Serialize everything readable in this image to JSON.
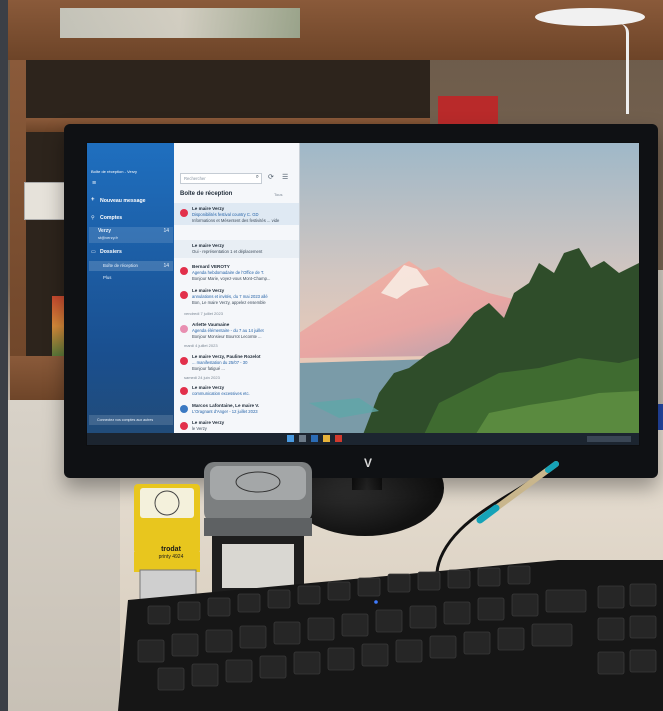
{
  "mail_app": {
    "window_title": "Boîte de réception - Verzy",
    "new_message": "Nouveau message",
    "accounts_label": "Comptes",
    "account_name": "Verzy",
    "account_email": "st@verzy.fr",
    "account_count": "14",
    "folders_label": "Dossiers",
    "folder_inbox": "Boîte de réception",
    "folder_inbox_count": "14",
    "folder_more": "Plus",
    "search_placeholder": "Rechercher",
    "list_header": "Boîte de réception",
    "filter_label": "Tous",
    "bottom_notice": "Connectez vos comptes aux autres",
    "items": [
      {
        "sender": "Le maire Verzy",
        "subject": "Disponibilités festival country C. GD",
        "preview": "Informations et Mésentent des festivités ... vide"
      },
      {
        "sender": "Le maire Verzy",
        "subject": "Oui - représentation 1 et déplacement",
        "preview": "... vide"
      },
      {
        "sender": "Bernard VEROTY",
        "subject": "Agenda hebdomadaire de l'Office de T.",
        "preview": "Bonjour Marie, voyez-vous Mont-Champ..."
      },
      {
        "sender": "Le maire Verzy",
        "subject": "annulations et invités, du 7 mai 2023 allé",
        "preview": "Bon, Le maire Verzy, appelez ensemble"
      }
    ],
    "group_day": "vendredi 7 juillet 2023",
    "items_b": [
      {
        "sender": "Arlette Vaumaine",
        "subject": "Agenda élémentaire - du 7 au 14 juillet",
        "preview": "Bonjour Monsieur Bourrot Lecomte ..."
      }
    ],
    "group_day_b": "mardi 4 juillet 2023",
    "items_c": [
      {
        "sender": "Le maire Verzy, Pauline Rozelot",
        "subject": "... manifestation du 25/07 - 30",
        "preview": "Bonjour fatigué ..."
      }
    ],
    "group_day_c": "samedi 24 juin 2023",
    "items_d": [
      {
        "sender": "Le maire Verzy",
        "subject": "communication excessives etc.",
        "preview": "..."
      },
      {
        "sender": "Marcos Lafontaine, Le maire V.",
        "subject": "L'Oragnant d'Anger - 12 juillet 2023",
        "preview": "..."
      },
      {
        "sender": "Le maire Verzy",
        "subject": "le Verzy",
        "preview": "..."
      }
    ]
  },
  "monitor_logo": "V",
  "stamps": {
    "yellow_brand": "trodat",
    "yellow_model": "printy 4924"
  },
  "colors": {
    "mail_blue": "#1f6fbf",
    "unread_red": "#e2304b",
    "pen_teal": "#16a3b8"
  }
}
